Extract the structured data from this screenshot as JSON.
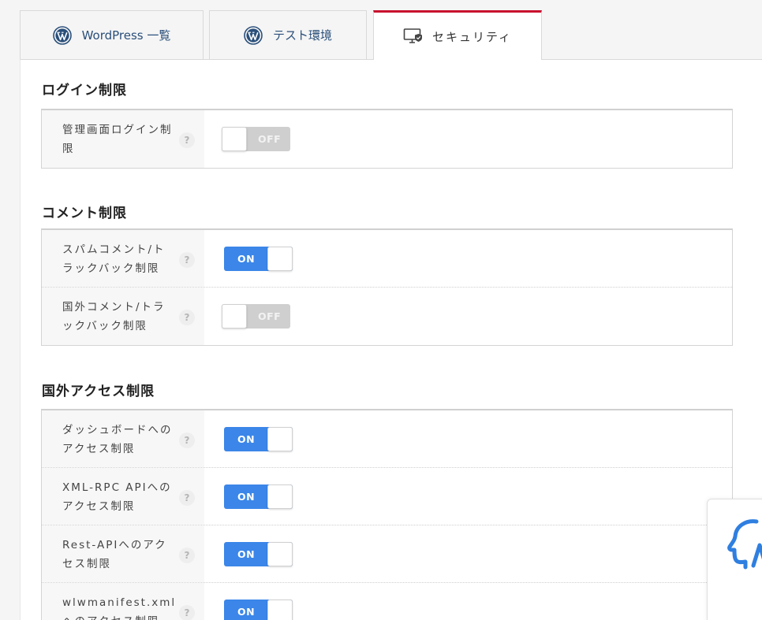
{
  "tabs": [
    {
      "label": "WordPress 一覧",
      "icon": "wordpress-icon",
      "active": false
    },
    {
      "label": "テスト環境",
      "icon": "wordpress-icon",
      "active": false
    },
    {
      "label": "セキュリティ",
      "icon": "monitor-shield-icon",
      "active": true
    }
  ],
  "sections": {
    "login": {
      "title": "ログイン制限",
      "rows": [
        {
          "label": "管理画面ログイン制限",
          "state": "OFF"
        }
      ]
    },
    "comment": {
      "title": "コメント制限",
      "rows": [
        {
          "label": "スパムコメント/トラックバック制限",
          "state": "ON"
        },
        {
          "label": "国外コメント/トラックバック制限",
          "state": "OFF"
        }
      ]
    },
    "foreign": {
      "title": "国外アクセス制限",
      "rows": [
        {
          "label": "ダッシュボードへのアクセス制限",
          "state": "ON"
        },
        {
          "label": "XML-RPC APIへのアクセス制限",
          "state": "ON"
        },
        {
          "label": "Rest-APIへのアクセス制限",
          "state": "ON"
        },
        {
          "label": "wlwmanifest.xmlへのアクセス制限",
          "state": "ON"
        }
      ]
    }
  },
  "help_glyph": "?",
  "colors": {
    "accent_tab": "#c8102e",
    "toggle_on": "#3b86e8",
    "toggle_off": "#cfcfcf",
    "tab_text": "#2a4f7a",
    "widget_icon": "#2f7fe0"
  }
}
